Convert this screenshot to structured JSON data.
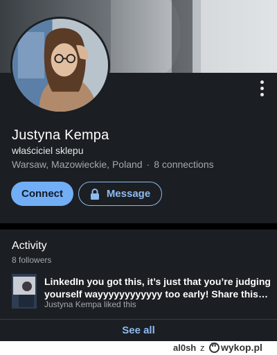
{
  "profile": {
    "name": "Justyna Kempa",
    "headline": "właściciel sklepu",
    "location": "Warsaw, Mazowieckie, Poland",
    "separator": "·",
    "connections": "8 connections"
  },
  "actions": {
    "connect_label": "Connect",
    "message_label": "Message"
  },
  "activity": {
    "title": "Activity",
    "followers": "8 followers",
    "post": {
      "text": "LinkedIn you got this, it’s just that you’re judging yourself wayyyyyyyyyyyy too early! Share this…",
      "meta": "Justyna Kempa liked this"
    },
    "see_all_label": "See all"
  },
  "footer": {
    "user": "al0sh",
    "connector": "z",
    "site": "wykop.pl"
  },
  "colors": {
    "background": "#1b1f23",
    "accent": "#72aef5",
    "link": "#8fbaf0"
  },
  "icons": [
    "more-vertical-icon",
    "lock-icon",
    "wykop-logo-icon"
  ]
}
